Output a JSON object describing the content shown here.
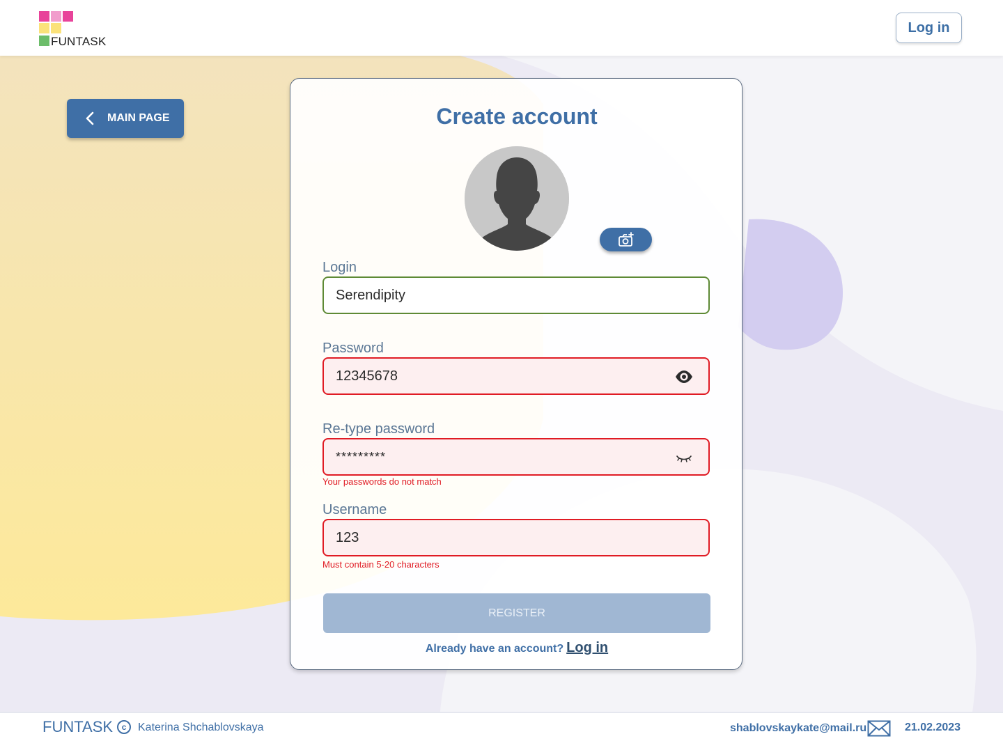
{
  "app": {
    "name": "FUNTASK"
  },
  "header": {
    "login_label": "Log in"
  },
  "nav": {
    "main_page_label": "MAIN PAGE"
  },
  "form": {
    "title": "Create account",
    "login": {
      "label": "Login",
      "value": "Serendipity",
      "state": "valid"
    },
    "password": {
      "label": "Password",
      "value": "12345678",
      "state": "error",
      "icon": "eye-icon"
    },
    "retype_password": {
      "label": "Re-type password",
      "value": "*********",
      "state": "error",
      "icon": "eye-closed-icon",
      "error": "Your passwords do not match"
    },
    "username": {
      "label": "Username",
      "value": "123",
      "state": "error",
      "error": "Must contain 5-20 characters"
    },
    "register_label": "REGISTER",
    "already_text": "Already have an account?",
    "login_link": "Log in"
  },
  "footer": {
    "brand": "FUNTASK",
    "copyright_symbol": "c",
    "author": "Katerina Shchablovskaya",
    "email": "shablovskaykate@mail.ru",
    "date": "21.02.2023"
  },
  "colors": {
    "accent": "#3f6fa6",
    "error": "#e01b24",
    "valid": "#5e8a35",
    "register_disabled": "#a0b7d3"
  }
}
